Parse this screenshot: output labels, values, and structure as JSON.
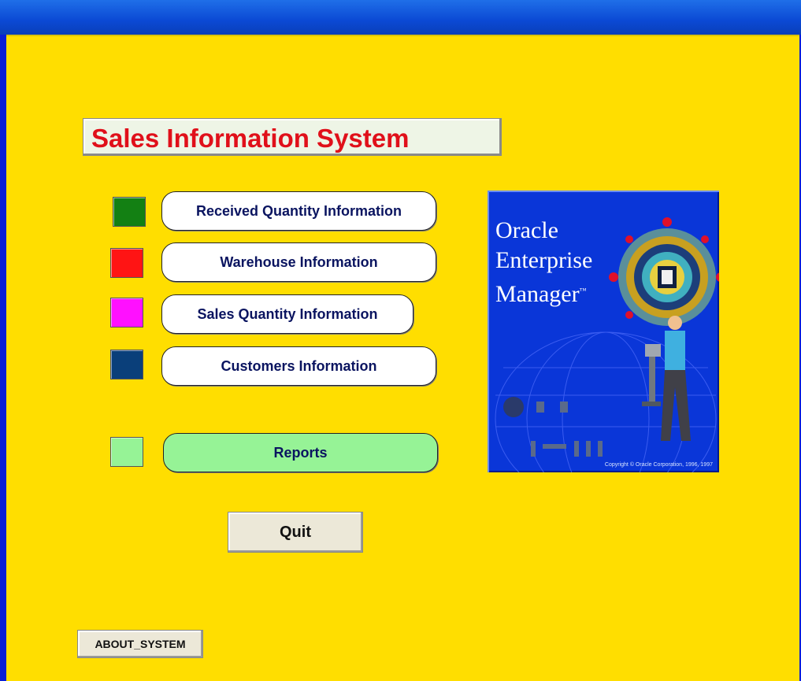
{
  "app": {
    "title": "Sales Information System"
  },
  "menu": {
    "items": [
      {
        "label": "Received Quantity Information",
        "color": "#138013"
      },
      {
        "label": "Warehouse Information",
        "color": "#ff1414"
      },
      {
        "label": "Sales Quantity Information",
        "color": "#ff10ff"
      },
      {
        "label": "Customers Information",
        "color": "#0a3f7a"
      },
      {
        "label": "Reports",
        "color": "#96f396"
      }
    ]
  },
  "logo": {
    "line1": "Oracle",
    "line2": "Enterprise",
    "line3": "Manager",
    "trademark": "™",
    "copyright": "Copyright © Oracle Corporation, 1996, 1997"
  },
  "buttons": {
    "quit": "Quit",
    "about": "ABOUT_SYSTEM"
  }
}
